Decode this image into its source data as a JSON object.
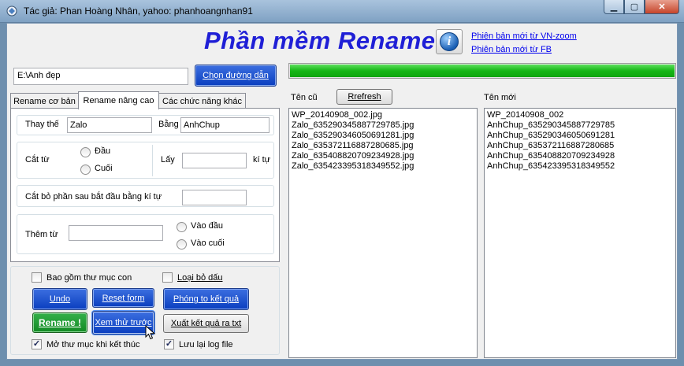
{
  "window": {
    "title": "Tác giả: Phan Hoàng Nhân, yahoo: phanhoangnhan91"
  },
  "header": {
    "app_title": "Phần mềm Rename",
    "link_vnzoom": "Phiên bản mới từ VN-zoom",
    "link_fb": "Phiên bản mới từ FB"
  },
  "path": {
    "value": "E:\\Anh đẹp",
    "choose_button": "Chọn đường dẫn"
  },
  "progress": {
    "fraction": 1.0
  },
  "tabs": [
    {
      "label": "Rename cơ bản",
      "active": false
    },
    {
      "label": "Rename nâng cao",
      "active": true
    },
    {
      "label": "Các chức năng khác",
      "active": false
    }
  ],
  "advanced": {
    "replace_label": "Thay thế",
    "replace_value": "Zalo",
    "with_label": "Bằng",
    "with_value": "AnhChup",
    "cut_label": "Cắt từ",
    "cut_start": "Đầu",
    "cut_end": "Cuối",
    "take_label": "Lấy",
    "take_value": "",
    "chars_label": "kí tự",
    "trim_label": "Cắt bỏ phần sau bắt đầu bằng kí tự",
    "trim_value": "",
    "add_label": "Thêm từ",
    "add_value": "",
    "add_start": "Vào đầu",
    "add_end": "Vào cuối"
  },
  "options": {
    "include_subfolders": {
      "label": "Bao gồm thư mục con",
      "checked": false
    },
    "remove_accents": {
      "label": "Loại bỏ dấu",
      "checked": false
    },
    "open_folder": {
      "label": "Mở thư mục khi kết thúc",
      "checked": true
    },
    "save_log": {
      "label": "Lưu lại log file",
      "checked": true
    }
  },
  "buttons": {
    "undo": "Undo",
    "reset": "Reset form",
    "zoom_result": "Phóng to kết quả",
    "rename": "Rename !",
    "preview": "Xem thử trước",
    "export": "Xuất kết quả ra txt",
    "refresh": "Rrefresh"
  },
  "old_list": {
    "header": "Tên cũ",
    "items": [
      "WP_20140908_002.jpg",
      "Zalo_635290345887729785.jpg",
      "Zalo_635290346050691281.jpg",
      "Zalo_635372116887280685.jpg",
      "Zalo_635408820709234928.jpg",
      "Zalo_635423395318349552.jpg"
    ]
  },
  "new_list": {
    "header": "Tên mới",
    "items": [
      "WP_20140908_002",
      "AnhChup_635290345887729785",
      "AnhChup_635290346050691281",
      "AnhChup_635372116887280685",
      "AnhChup_635408820709234928",
      "AnhChup_635423395318349552"
    ]
  },
  "colors": {
    "title_blue": "#1f1fd6",
    "progress_green": "#16b616",
    "button_blue": "#0a3ebf",
    "button_green": "#138a24"
  }
}
